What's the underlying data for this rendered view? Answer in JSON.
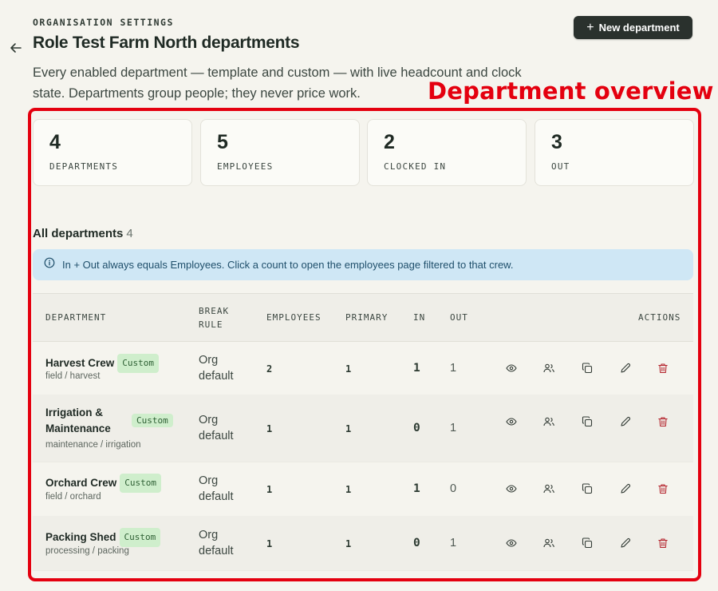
{
  "header": {
    "eyebrow": "ORGANISATION SETTINGS",
    "title": "Role Test Farm North departments",
    "subtitle": "Every enabled department — template and custom — with live headcount and clock state. Departments group people; they never price work.",
    "new_button_label": "New department",
    "new_button_icon": "plus-icon"
  },
  "annotation": {
    "label": "Department overview",
    "color": "#e4000f"
  },
  "stats": [
    {
      "value": "4",
      "label": "DEPARTMENTS"
    },
    {
      "value": "5",
      "label": "EMPLOYEES"
    },
    {
      "value": "2",
      "label": "CLOCKED IN"
    },
    {
      "value": "3",
      "label": "OUT"
    }
  ],
  "section": {
    "title": "All departments",
    "count": "4"
  },
  "info_banner": {
    "icon": "info-icon",
    "text": "In + Out always equals Employees. Click a count to open the employees page filtered to that crew."
  },
  "table": {
    "columns": {
      "department": "DEPARTMENT",
      "break_rule_1": "BREAK",
      "break_rule_2": "RULE",
      "employees": "EMPLOYEES",
      "primary": "PRIMARY",
      "in": "IN",
      "out": "OUT",
      "actions": "ACTIONS"
    },
    "rows": [
      {
        "name": "Harvest Crew",
        "name_line1": "",
        "name_line2": "",
        "badge": "Custom",
        "path": "field / harvest",
        "rule_1": "Org",
        "rule_2": "default",
        "employees": "2",
        "primary": "1",
        "in": "1",
        "out": "1"
      },
      {
        "name": "",
        "name_line1": "Irrigation &",
        "name_line2": "Maintenance",
        "badge": "Custom",
        "path": "maintenance / irrigation",
        "rule_1": "Org",
        "rule_2": "default",
        "employees": "1",
        "primary": "1",
        "in": "0",
        "out": "1"
      },
      {
        "name": "Orchard Crew",
        "name_line1": "",
        "name_line2": "",
        "badge": "Custom",
        "path": "field / orchard",
        "rule_1": "Org",
        "rule_2": "default",
        "employees": "1",
        "primary": "1",
        "in": "1",
        "out": "0"
      },
      {
        "name": "Packing Shed",
        "name_line1": "",
        "name_line2": "",
        "badge": "Custom",
        "path": "processing / packing",
        "rule_1": "Org",
        "rule_2": "default",
        "employees": "1",
        "primary": "1",
        "in": "0",
        "out": "1"
      }
    ],
    "action_icons": [
      "eye-icon",
      "users-icon",
      "copy-icon",
      "pencil-icon",
      "trash-icon"
    ]
  },
  "colors": {
    "background": "#f5f4ee",
    "primary_button": "#2a312d",
    "badge_bg": "#cfeecc",
    "info_bg": "#cfe7f5",
    "danger": "#b4232c"
  }
}
